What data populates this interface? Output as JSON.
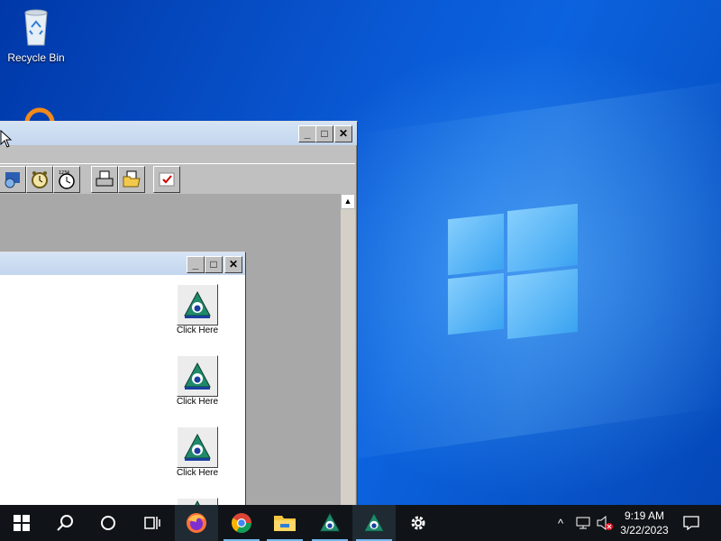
{
  "desktop": {
    "icons": [
      {
        "label": "Recycle Bin",
        "icon": "recycle-bin-icon"
      },
      {
        "label": "",
        "icon": "app-ring-icon"
      }
    ]
  },
  "main_window": {
    "title": "",
    "controls": {
      "minimize": "_",
      "maximize": "□",
      "close": "✕"
    },
    "toolbar": [
      "app-1-icon",
      "alarm-clock-icon",
      "stopwatch-icon",
      "printer-icon",
      "open-folder-icon",
      "checklist-icon"
    ]
  },
  "child_window": {
    "title": "",
    "controls": {
      "minimize": "_",
      "maximize": "□",
      "close": "✕"
    },
    "tiles": [
      {
        "label": "Click Here"
      },
      {
        "label": "Click Here"
      },
      {
        "label": "Click Here"
      },
      {
        "label": ""
      }
    ]
  },
  "taskbar": {
    "items": [
      "start-icon",
      "search-icon",
      "cortana-icon",
      "task-view-icon",
      "firefox-icon",
      "chrome-icon",
      "file-explorer-icon",
      "app-triangle-icon",
      "app-triangle-icon",
      "settings-icon"
    ],
    "tray": {
      "chevron": "^",
      "clock_time": "9:19 AM",
      "clock_date": "3/22/2023"
    }
  },
  "colors": {
    "taskbar": "#101418",
    "wallpaper_blue": "#0a5ad6",
    "window_gray": "#c0c0c0",
    "titlebar": "#c3d6ee",
    "accent_underline": "#76b9ed"
  }
}
